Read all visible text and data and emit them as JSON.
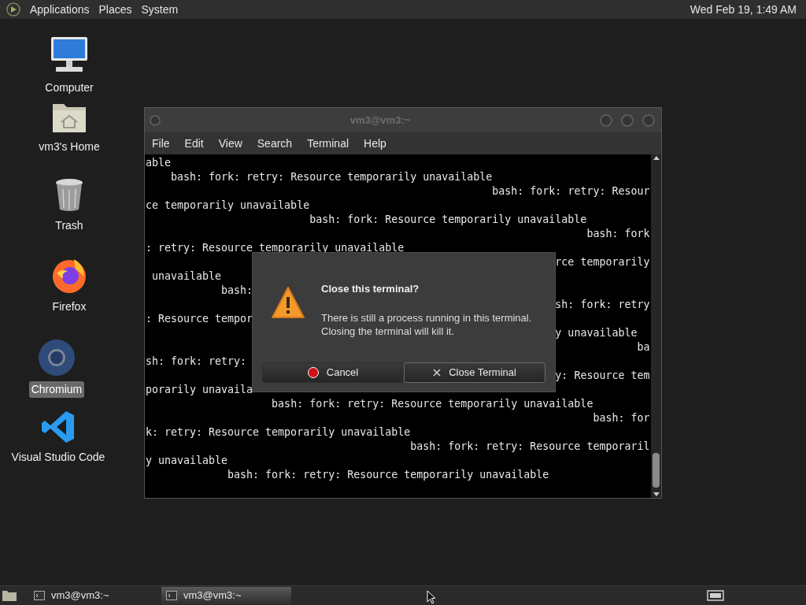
{
  "top_panel": {
    "menus": [
      "Applications",
      "Places",
      "System"
    ],
    "clock": "Wed Feb 19, 1:49 AM"
  },
  "desktop_icons": [
    {
      "label": "Computer",
      "kind": "computer",
      "selected": false
    },
    {
      "label": "vm3's Home",
      "kind": "home",
      "selected": false
    },
    {
      "label": "Trash",
      "kind": "trash",
      "selected": false
    },
    {
      "label": "Firefox",
      "kind": "firefox",
      "selected": false
    },
    {
      "label": "Chromium",
      "kind": "chromium",
      "selected": true
    },
    {
      "label": "Visual Studio Code",
      "kind": "vscode",
      "selected": false
    }
  ],
  "terminal": {
    "title": "vm3@vm3:~",
    "menu": [
      "File",
      "Edit",
      "View",
      "Search",
      "Terminal",
      "Help"
    ],
    "lines": [
      "able",
      "    bash: fork: retry: Resource temporarily unavailable",
      "                                                       bash: fork: retry: Resour",
      "ce temporarily unavailable",
      "                          bash: fork: Resource temporarily unavailable",
      "                                                                      bash: fork",
      ": retry: Resource temporarily unavailable",
      "                                                                 rce temporarily",
      " unavailable",
      "            bash:",
      "                                                                 sh: fork: retry",
      ": Resource tempor",
      "                                                                 y unavailable",
      "                                                                              ba",
      "sh: fork: retry:",
      "                                                                 y: Resource tem",
      "porarily unavaila",
      "                    bash: fork: retry: Resource temporarily unavailable",
      "                                                                       bash: for",
      "k: retry: Resource temporarily unavailable",
      "                                          bash: fork: retry: Resource temporaril",
      "y unavailable",
      "             bash: fork: retry: Resource temporarily unavailable"
    ]
  },
  "dialog": {
    "title": "Close this terminal?",
    "message": "There is still a process running in this terminal.\nClosing the terminal will kill it.",
    "buttons": [
      {
        "label": "Cancel",
        "kind": "cancel"
      },
      {
        "label": "Close Terminal",
        "kind": "close"
      }
    ]
  },
  "taskbar": {
    "tasks": [
      {
        "label": "vm3@vm3:~",
        "selected": false
      },
      {
        "label": "vm3@vm3:~",
        "selected": true
      }
    ]
  }
}
